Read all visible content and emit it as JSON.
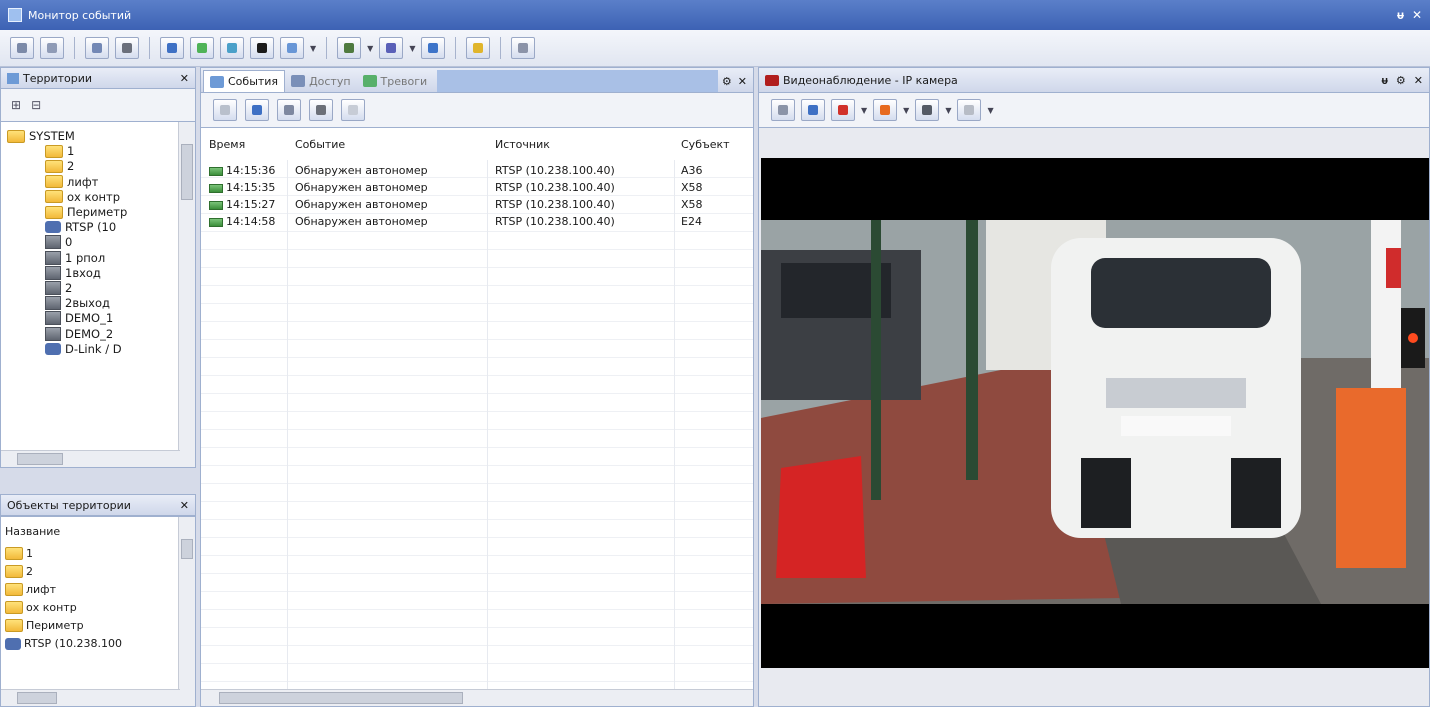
{
  "window": {
    "title": "Монитор событий",
    "controls": [
      "ᵾ",
      "✕"
    ]
  },
  "toolbar": {
    "buttons": [
      "grid-view",
      "layout",
      "save",
      "eye",
      "arrow",
      "info",
      "edit",
      "black-square",
      "window",
      "dropdown-a",
      "dropdown-b",
      "people",
      "key",
      "check"
    ]
  },
  "territories": {
    "title": "Территории",
    "close": "✕",
    "tools": [
      "⊞",
      "⊟"
    ],
    "tree": [
      {
        "label": "SYSTEM",
        "icon": "folder",
        "indent": 0
      },
      {
        "label": "1",
        "icon": "folder",
        "indent": 1
      },
      {
        "label": "2",
        "icon": "folder",
        "indent": 1
      },
      {
        "label": "лифт",
        "icon": "folder",
        "indent": 1
      },
      {
        "label": "ох контр",
        "icon": "folder",
        "indent": 1
      },
      {
        "label": "Периметр",
        "icon": "folder",
        "indent": 1
      },
      {
        "label": "RTSP (10",
        "icon": "camera",
        "indent": 1
      },
      {
        "label": "0",
        "icon": "device",
        "indent": 1
      },
      {
        "label": "1 рпол",
        "icon": "device",
        "indent": 1
      },
      {
        "label": "1вход",
        "icon": "device",
        "indent": 1
      },
      {
        "label": "2",
        "icon": "device",
        "indent": 1
      },
      {
        "label": "2выход",
        "icon": "device",
        "indent": 1
      },
      {
        "label": "DEMO_1",
        "icon": "device",
        "indent": 1
      },
      {
        "label": "DEMO_2",
        "icon": "device",
        "indent": 1
      },
      {
        "label": "D-Link / D",
        "icon": "camera",
        "indent": 1
      }
    ]
  },
  "objects": {
    "title": "Объекты территории",
    "close": "✕",
    "column": "Название",
    "items": [
      "1",
      "2",
      "лифт",
      "ох контр",
      "Периметр",
      "RTSP (10.238.100"
    ]
  },
  "events": {
    "tabs": [
      {
        "label": "События",
        "active": true
      },
      {
        "label": "Доступ",
        "active": false
      },
      {
        "label": "Тревоги",
        "active": false
      }
    ],
    "tab_controls": [
      "⚙",
      "✕"
    ],
    "columns": [
      "Время",
      "Событие",
      "Источник",
      "Субъект"
    ],
    "rows": [
      {
        "time": "14:15:36",
        "event": "Обнаружен автономер",
        "source": "RTSP (10.238.100.40)",
        "subject": "А36"
      },
      {
        "time": "14:15:35",
        "event": "Обнаружен автономер",
        "source": "RTSP (10.238.100.40)",
        "subject": "Х58"
      },
      {
        "time": "14:15:27",
        "event": "Обнаружен автономер",
        "source": "RTSP (10.238.100.40)",
        "subject": "Х58"
      },
      {
        "time": "14:14:58",
        "event": "Обнаружен автономер",
        "source": "RTSP (10.238.100.40)",
        "subject": "Е24"
      }
    ]
  },
  "video": {
    "title": "Видеонаблюдение - IP камера",
    "controls": [
      "ᵾ",
      "⚙",
      "✕"
    ]
  },
  "colors": {
    "titlebar": "#3d62b4",
    "pane_border": "#9fb0cf",
    "tab_fill": "#a9c0e6"
  }
}
